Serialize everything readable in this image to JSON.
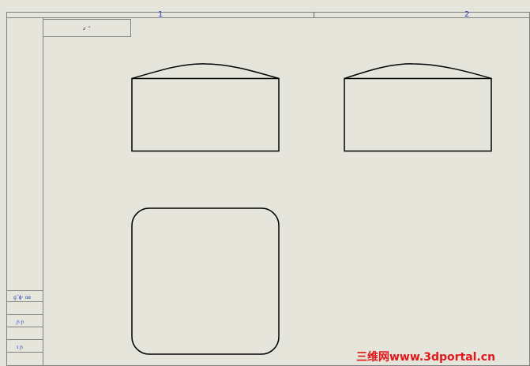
{
  "drawing": {
    "zones": [
      "1",
      "2"
    ],
    "title_tab": "ɹˑ ′ʻ",
    "side_labels": [
      "ɡ˝ɸˑ ɑɐ",
      "ɲ ɲ",
      "ɪ ɲ"
    ],
    "watermark": "三维网www.3dportal.cn"
  },
  "colors": {
    "sheet": "#e6e5dc",
    "line": "#000000",
    "zone_text": "#2040c0",
    "watermark": "#e01818"
  }
}
